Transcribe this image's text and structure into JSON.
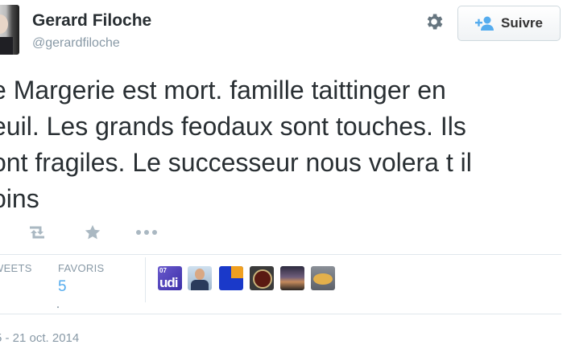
{
  "header": {
    "display_name": "Gerard Filoche",
    "handle": "@gerardfiloche",
    "follow_label": "Suivre",
    "icons": [
      "gear-icon",
      "follow-user-icon"
    ]
  },
  "tweet": {
    "lines": [
      "e Margerie est mort. famille taittinger en",
      "euil. Les grands feodaux sont touches. Ils",
      "ont fragiles. Le successeur nous volera t il",
      "oins"
    ]
  },
  "actions": [
    "retweet-icon",
    "favorite-star-icon",
    "more-icon"
  ],
  "stats": {
    "retweets_label": "WEETS",
    "favorites_label": "FAVORIS",
    "favorites_count": "5"
  },
  "favoriters": [
    {
      "name": "udi",
      "badge": "07",
      "label": "udi"
    },
    {
      "name": "man-in-suit"
    },
    {
      "name": "blue-square"
    },
    {
      "name": "emblem"
    },
    {
      "name": "landscape"
    },
    {
      "name": "yellow-object"
    }
  ],
  "timestamp": "5 - 21 oct. 2014",
  "colors": {
    "accent": "#55acee",
    "muted": "#8899a6",
    "text": "#292f33",
    "divider": "#e1e8ed"
  }
}
